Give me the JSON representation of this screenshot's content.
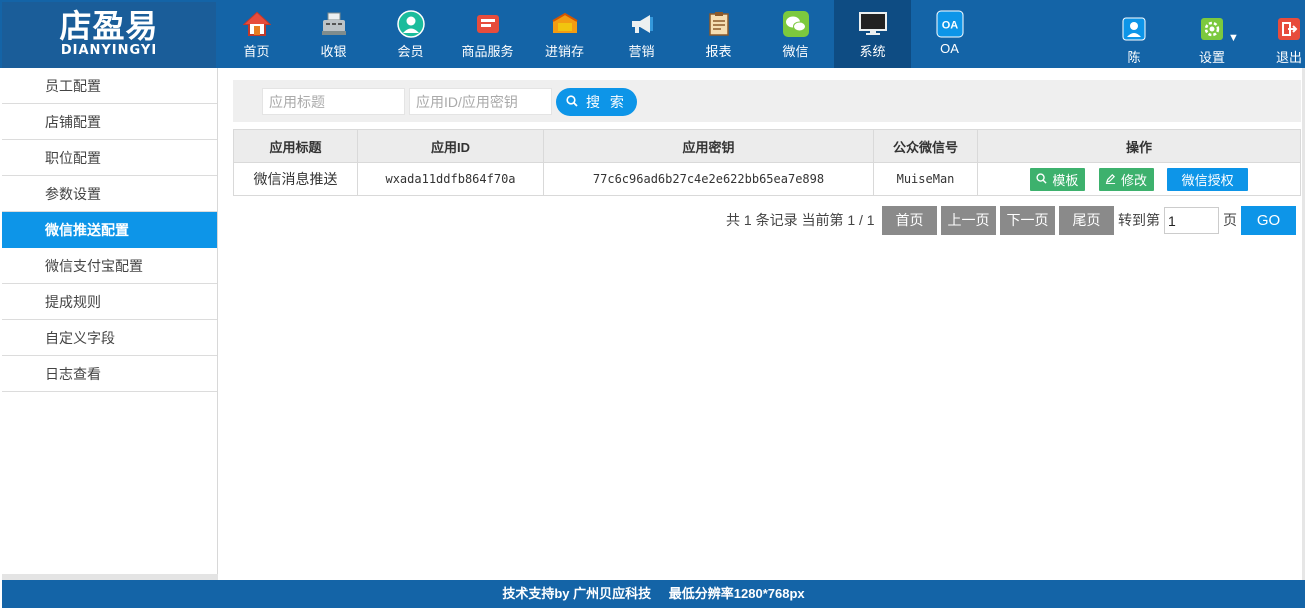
{
  "logo": {
    "main": "店盈易",
    "sub": "DIANYINGYI"
  },
  "nav": [
    {
      "label": "首页",
      "icon": "home-icon"
    },
    {
      "label": "收银",
      "icon": "cash-register-icon"
    },
    {
      "label": "会员",
      "icon": "member-icon"
    },
    {
      "label": "商品服务",
      "icon": "goods-icon"
    },
    {
      "label": "进销存",
      "icon": "inventory-icon"
    },
    {
      "label": "营销",
      "icon": "megaphone-icon"
    },
    {
      "label": "报表",
      "icon": "report-icon"
    },
    {
      "label": "微信",
      "icon": "wechat-icon"
    },
    {
      "label": "系统",
      "icon": "monitor-icon",
      "active": true
    },
    {
      "label": "OA",
      "icon": "oa-icon",
      "badge": "OA"
    }
  ],
  "header_right": {
    "user": "陈",
    "settings": "设置",
    "logout": "退出"
  },
  "sidebar": {
    "items": [
      {
        "label": "员工配置"
      },
      {
        "label": "店铺配置"
      },
      {
        "label": "职位配置"
      },
      {
        "label": "参数设置"
      },
      {
        "label": "微信推送配置",
        "active": true
      },
      {
        "label": "微信支付宝配置"
      },
      {
        "label": "提成规则"
      },
      {
        "label": "自定义字段"
      },
      {
        "label": "日志查看"
      }
    ]
  },
  "search": {
    "title_placeholder": "应用标题",
    "id_placeholder": "应用ID/应用密钥",
    "button_label": "搜 索"
  },
  "table": {
    "headers": [
      "应用标题",
      "应用ID",
      "应用密钥",
      "公众微信号",
      "操作"
    ],
    "rows": [
      {
        "title": "微信消息推送",
        "app_id": "wxada11ddfb864f70a",
        "app_secret": "77c6c96ad6b27c4e2e622bb65ea7e898",
        "account": "MuiseMan",
        "actions": {
          "template": "模板",
          "edit": "修改",
          "authorize": "微信授权"
        }
      }
    ]
  },
  "pagination": {
    "summary": "共 1 条记录 当前第 1 / 1",
    "first": "首页",
    "prev": "上一页",
    "next": "下一页",
    "last": "尾页",
    "goto_label": "转到第",
    "page_value": "1",
    "page_suffix": "页",
    "go": "GO"
  },
  "footer": {
    "support": "技术支持by 广州贝应科技",
    "resolution": "最低分辨率1280*768px"
  },
  "colors": {
    "header_bg": "#1464a7",
    "accent": "#0d95e8",
    "green": "#3db16d",
    "pager_gray": "#8a8a8a"
  }
}
